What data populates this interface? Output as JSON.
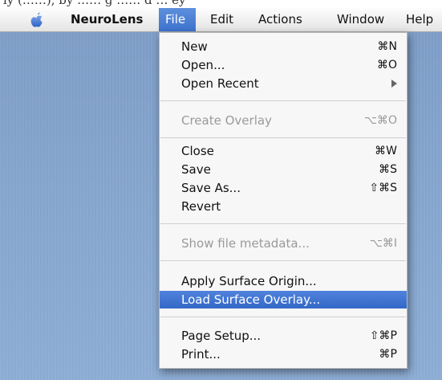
{
  "caption_fragment": "ly (……), by …… g …… d … ey",
  "menubar": {
    "app_name": "NeuroLens",
    "menus": [
      "File",
      "Edit",
      "Actions",
      "Window",
      "Help"
    ],
    "active_menu": "File",
    "icon": "apple-icon"
  },
  "file_menu": {
    "items": [
      {
        "label": "New",
        "shortcut": "⌘N",
        "enabled": true
      },
      {
        "label": "Open...",
        "shortcut": "⌘O",
        "enabled": true
      },
      {
        "label": "Open Recent",
        "shortcut": "",
        "enabled": true,
        "submenu": true
      },
      {
        "label": "Create Overlay",
        "shortcut": "⌥⌘O",
        "enabled": false
      },
      {
        "label": "Close",
        "shortcut": "⌘W",
        "enabled": true
      },
      {
        "label": "Save",
        "shortcut": "⌘S",
        "enabled": true
      },
      {
        "label": "Save As...",
        "shortcut": "⇧⌘S",
        "enabled": true
      },
      {
        "label": "Revert",
        "shortcut": "",
        "enabled": true
      },
      {
        "label": "Show file metadata...",
        "shortcut": "⌥⌘I",
        "enabled": false
      },
      {
        "label": "Apply Surface Origin...",
        "shortcut": "",
        "enabled": true
      },
      {
        "label": "Load Surface Overlay...",
        "shortcut": "",
        "enabled": true,
        "highlighted": true
      },
      {
        "label": "Page Setup...",
        "shortcut": "⇧⌘P",
        "enabled": true
      },
      {
        "label": "Print...",
        "shortcut": "⌘P",
        "enabled": true
      }
    ]
  },
  "colors": {
    "highlight": "#3e73cf",
    "desktop": "#86a6cf",
    "disabled_text": "#9a9a9a"
  }
}
